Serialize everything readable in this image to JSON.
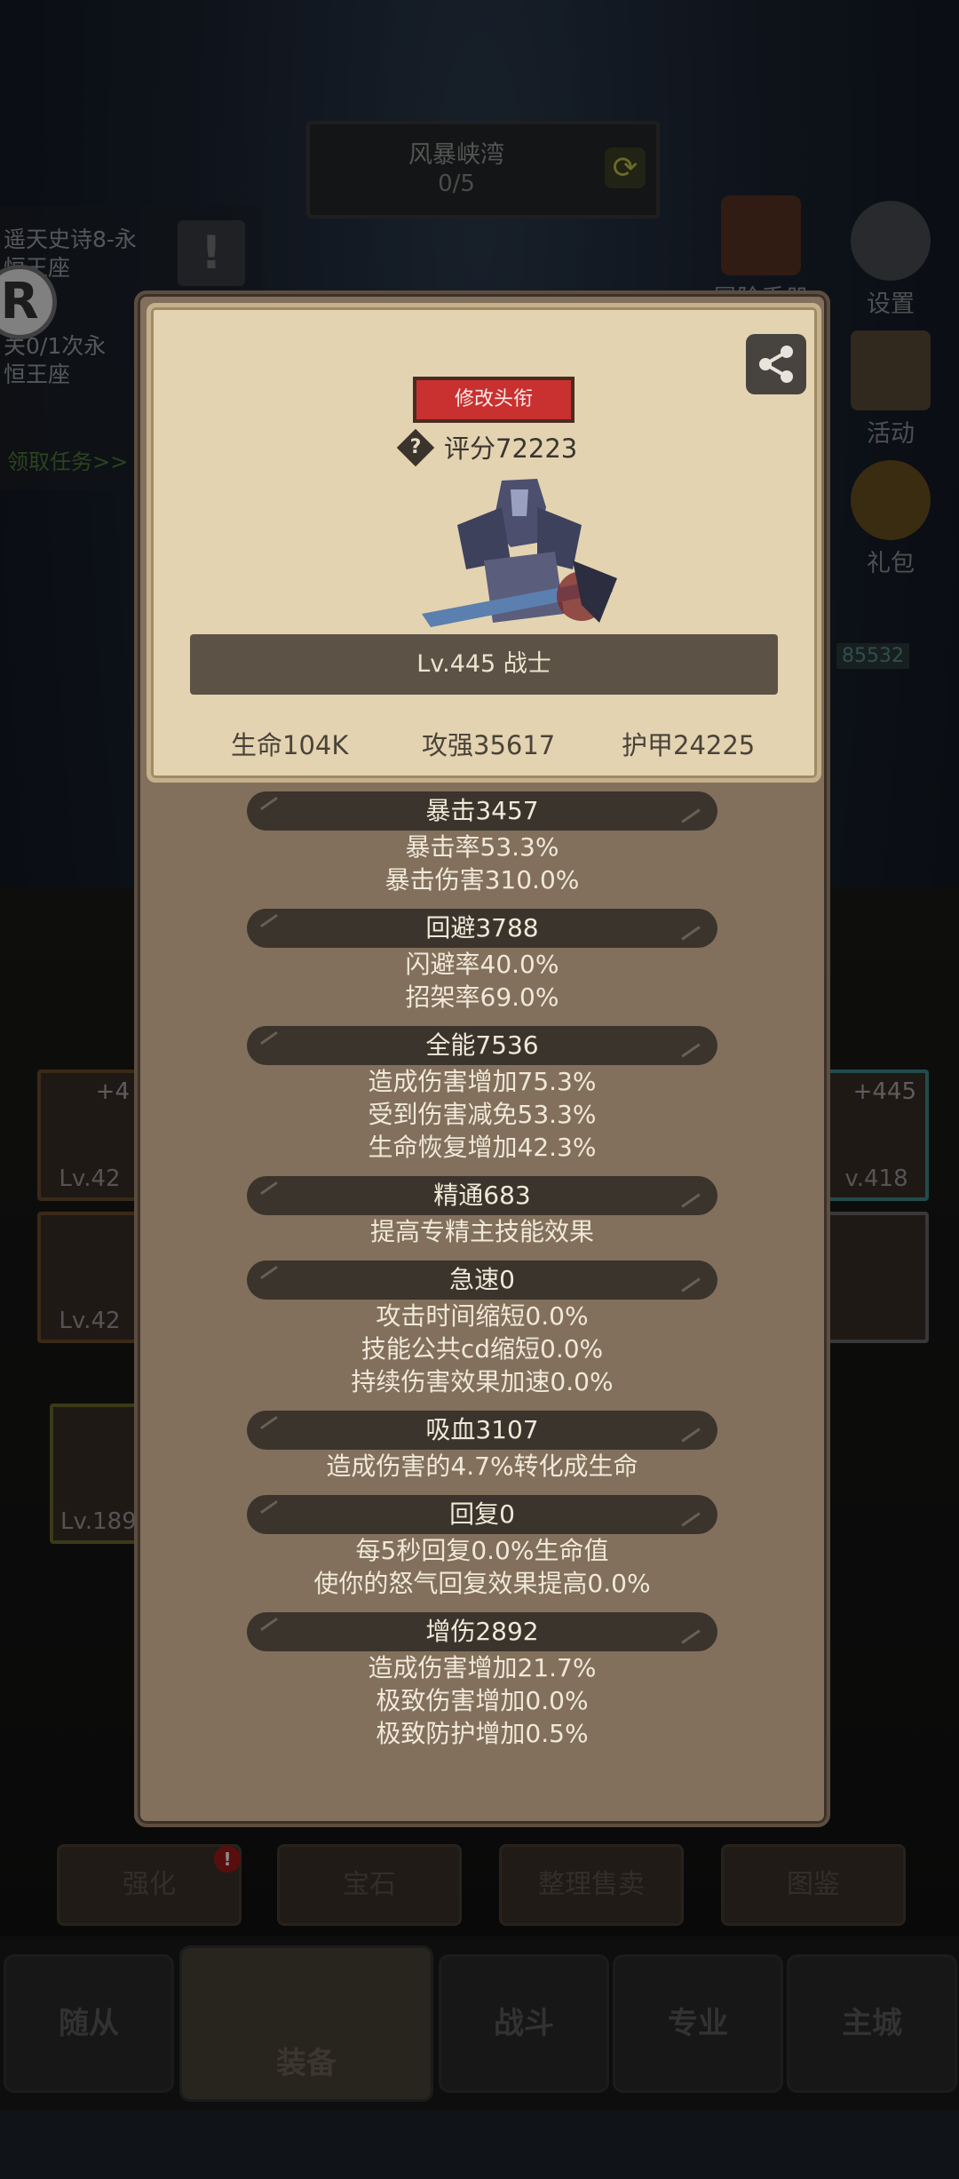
{
  "stage": {
    "title": "风暴峡湾",
    "count": "0/5"
  },
  "quest": {
    "line1": "遥天史诗8-永",
    "line2": "恒王座",
    "line3": "关0/1次永",
    "line4": "恒王座",
    "link": "领取任务>>",
    "warn": "!",
    "badge": "R"
  },
  "side_menu": {
    "adventure": "冒险手册",
    "settings": "设置",
    "activity": "活动",
    "gift": "礼包"
  },
  "counter": "85532",
  "equip": {
    "left1_plus": "+4",
    "left1_level": "Lv.42",
    "left2_level": "Lv.42",
    "right1_plus": "+445",
    "right1_level": "v.418",
    "weapon_level": "Lv.189"
  },
  "actions": {
    "strengthen": "强化",
    "gem": "宝石",
    "sort_sell": "整理售卖",
    "codex": "图鉴",
    "alert": "!"
  },
  "nav": {
    "follower": "随从",
    "equipment": "装备",
    "battle": "战斗",
    "profession": "专业",
    "city": "主城"
  },
  "profile": {
    "edit_title": "修改头衔",
    "help": "?",
    "score": "评分72223",
    "level_class": "Lv.445 战士",
    "hp": "生命104K",
    "attack": "攻强35617",
    "armor": "护甲24225"
  },
  "stats": {
    "crit": {
      "title": "暴击3457",
      "lines": [
        "暴击率53.3%",
        "暴击伤害310.0%"
      ]
    },
    "dodge": {
      "title": "回避3788",
      "lines": [
        "闪避率40.0%",
        "招架率69.0%"
      ]
    },
    "versatility": {
      "title": "全能7536",
      "lines": [
        "造成伤害增加75.3%",
        "受到伤害减免53.3%",
        "生命恢复增加42.3%"
      ]
    },
    "mastery": {
      "title": "精通683",
      "lines": [
        "提高专精主技能效果"
      ]
    },
    "haste": {
      "title": "急速0",
      "lines": [
        "攻击时间缩短0.0%",
        "技能公共cd缩短0.0%",
        "持续伤害效果加速0.0%"
      ]
    },
    "leech": {
      "title": "吸血3107",
      "lines": [
        "造成伤害的4.7%转化成生命"
      ]
    },
    "regen": {
      "title": "回复0",
      "lines": [
        "每5秒回复0.0%生命值",
        "使你的怒气回复效果提高0.0%"
      ]
    },
    "dmg_bonus": {
      "title": "增伤2892",
      "lines": [
        "造成伤害增加21.7%",
        "极致伤害增加0.0%",
        "极致防护增加0.5%"
      ]
    }
  }
}
